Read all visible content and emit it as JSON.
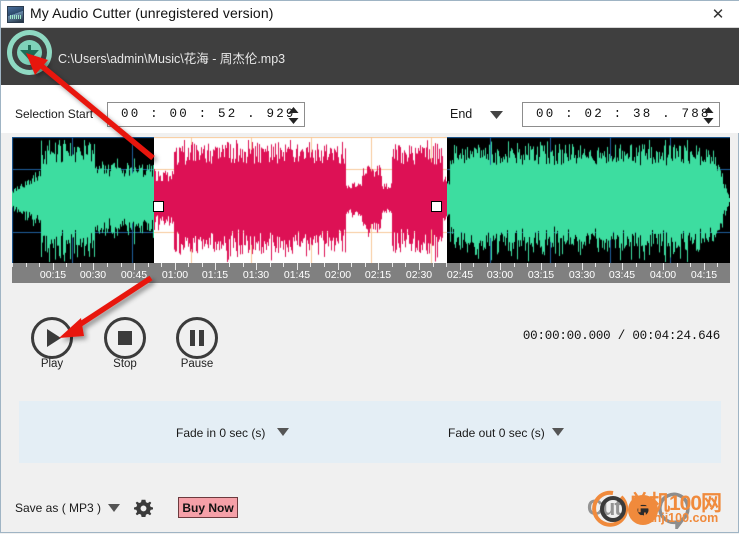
{
  "window": {
    "title": "My Audio Cutter (unregistered version)",
    "close_label": "✕",
    "icon": "app-icon"
  },
  "filebar": {
    "open_icon": "download-arrow-icon",
    "file_path": "C:\\Users\\admin\\Music\\花海 - 周杰伦.mp3"
  },
  "selection": {
    "start_label": "Selection Start",
    "start_value": "00 : 00 : 52 . 929",
    "end_label": "End",
    "end_caret_icon": "chevron-down-icon",
    "end_value": "00 : 02 : 38 . 788",
    "spinner_icon": "spinner-up-down-icon"
  },
  "waveform": {
    "selected_color": "#dd1155",
    "unselected_color": "#3ddda0",
    "background_unselected": "#000000",
    "background_selected": "#ffffff",
    "grid_color_unselected": "#1f5f9e",
    "grid_color_selected": "#f7c99a",
    "handle_left_icon": "selection-handle-left",
    "handle_right_icon": "selection-handle-right"
  },
  "ruler": {
    "labels": [
      "00:15",
      "00:30",
      "00:45",
      "01:00",
      "01:15",
      "01:30",
      "01:45",
      "02:00",
      "02:15",
      "02:30",
      "02:45",
      "03:00",
      "03:15",
      "03:30",
      "03:45",
      "04:00",
      "04:15"
    ]
  },
  "transport": {
    "play_label": "Play",
    "stop_label": "Stop",
    "pause_label": "Pause",
    "play_icon": "play-icon",
    "stop_icon": "stop-icon",
    "pause_icon": "pause-icon",
    "time_display": "00:00:00.000 / 00:04:24.646",
    "current_time": "00:00:00.000",
    "total_time": "00:04:24.646"
  },
  "fade": {
    "fade_in_label": "Fade in 0 sec (s)",
    "fade_out_label": "Fade out 0 sec (s)",
    "caret_icon": "chevron-down-icon"
  },
  "footer": {
    "save_as_label": "Save as ( MP3 )",
    "save_caret_icon": "chevron-down-icon",
    "settings_icon": "gear-icon",
    "buy_now_label": "Buy Now",
    "buy_now_color": "#f5a0a8"
  },
  "watermark": {
    "left_text": "Cut",
    "cn_text": "单机100网",
    "url_text": "danji100.com",
    "logo_icon": "disc-logo-icon"
  }
}
